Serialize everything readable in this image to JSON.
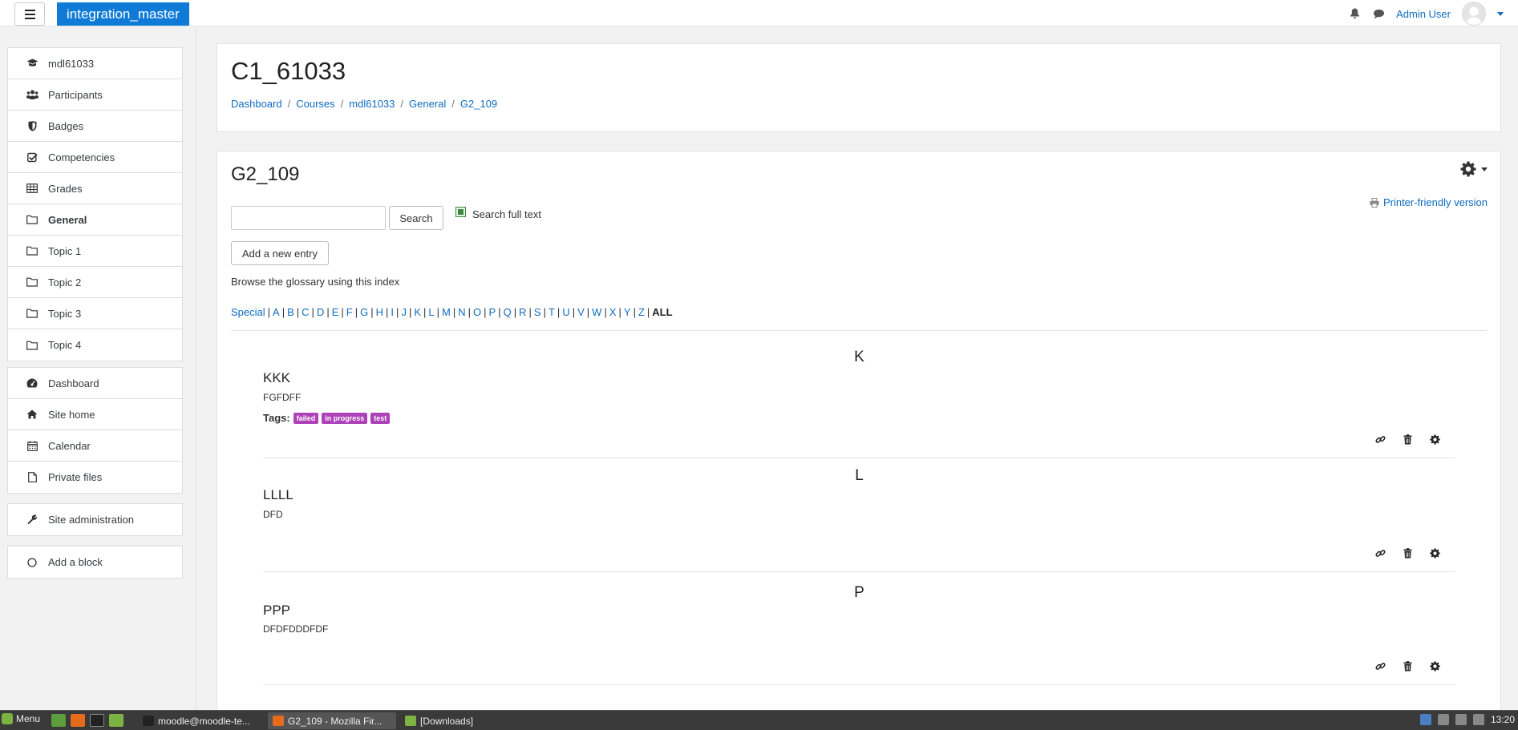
{
  "navbar": {
    "brand": "integration_master",
    "user_name": "Admin User"
  },
  "nav_primary": [
    {
      "label": "mdl61033",
      "icon": "graduation-cap-icon"
    },
    {
      "label": "Participants",
      "icon": "users-icon"
    },
    {
      "label": "Badges",
      "icon": "shield-icon"
    },
    {
      "label": "Competencies",
      "icon": "check-square-icon"
    },
    {
      "label": "Grades",
      "icon": "table-icon"
    },
    {
      "label": "General",
      "icon": "folder-icon"
    },
    {
      "label": "Topic 1",
      "icon": "folder-icon"
    },
    {
      "label": "Topic 2",
      "icon": "folder-icon"
    },
    {
      "label": "Topic 3",
      "icon": "folder-icon"
    },
    {
      "label": "Topic 4",
      "icon": "folder-icon"
    }
  ],
  "nav_secondary": [
    {
      "label": "Dashboard",
      "icon": "dashboard-icon"
    },
    {
      "label": "Site home",
      "icon": "home-icon"
    },
    {
      "label": "Calendar",
      "icon": "calendar-icon"
    },
    {
      "label": "Private files",
      "icon": "file-icon"
    }
  ],
  "nav_admin": {
    "label": "Site administration",
    "icon": "wrench-icon"
  },
  "nav_block": {
    "label": "Add a block",
    "icon": "circle-icon"
  },
  "header": {
    "course_title": "C1_61033",
    "breadcrumb": [
      "Dashboard",
      "Courses",
      "mdl61033",
      "General",
      "G2_109"
    ],
    "breadcrumb_sep": "/"
  },
  "main": {
    "heading": "G2_109",
    "printer_link": "Printer-friendly version",
    "search_button": "Search",
    "search_value": "",
    "fulltext_label": "Search full text",
    "fulltext_checked": true,
    "add_entry_button": "Add a new entry",
    "browse_text": "Browse the glossary using this index",
    "index_letters": [
      "Special",
      "A",
      "B",
      "C",
      "D",
      "E",
      "F",
      "G",
      "H",
      "I",
      "J",
      "K",
      "L",
      "M",
      "N",
      "O",
      "P",
      "Q",
      "R",
      "S",
      "T",
      "U",
      "V",
      "W",
      "X",
      "Y",
      "Z"
    ],
    "index_all": "ALL",
    "index_sep": "|",
    "entries": [
      {
        "letter": "K",
        "concept": "KKK",
        "definition": "FGFDFF",
        "tags_label": "Tags:",
        "tags": [
          "failed",
          "in progress",
          "test"
        ]
      },
      {
        "letter": "L",
        "concept": "LLLL",
        "definition": "DFD",
        "tags_label": "",
        "tags": []
      },
      {
        "letter": "P",
        "concept": "PPP",
        "definition": "DFDFDDDFDF",
        "tags_label": "",
        "tags": []
      }
    ]
  },
  "taskbar": {
    "menu_label": "Menu",
    "tasks": [
      "moodle@moodle-te...",
      "G2_109 - Mozilla Fir...",
      "[Downloads]"
    ],
    "active_task": "G2_109 - Mozilla Fir...",
    "clock": "13:20"
  },
  "colors": {
    "brand": "#0f7bd7",
    "link": "#0f6cbf",
    "tag": "#ad42b8"
  }
}
